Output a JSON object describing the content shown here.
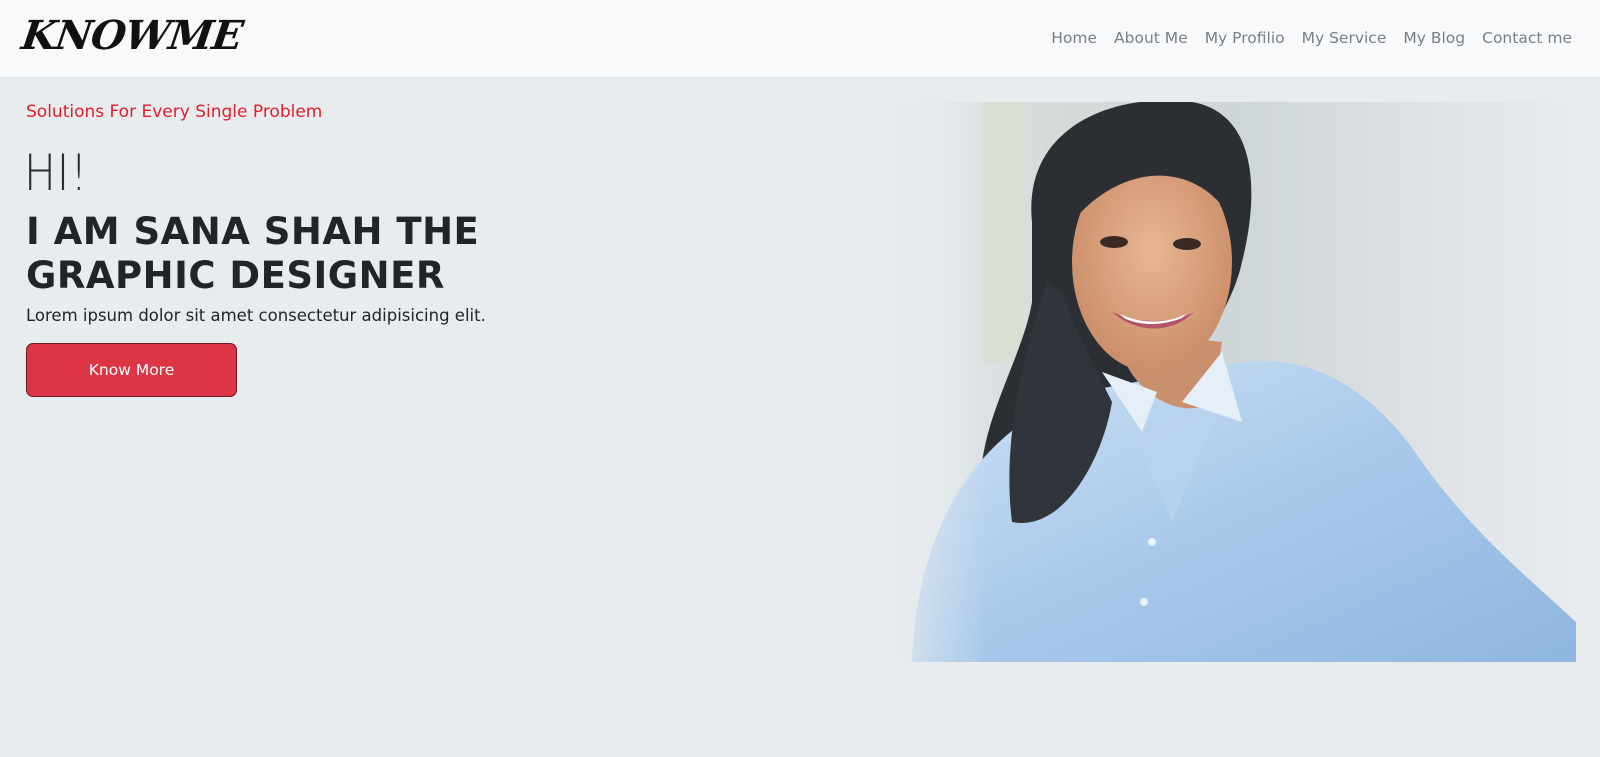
{
  "brand": {
    "name": "KNOWME"
  },
  "nav": {
    "items": [
      {
        "label": "Home"
      },
      {
        "label": "About Me"
      },
      {
        "label": "My Profilio"
      },
      {
        "label": "My Service"
      },
      {
        "label": "My Blog"
      },
      {
        "label": "Contact me"
      }
    ]
  },
  "hero": {
    "tagline": "Solutions For Every Single Problem",
    "greeting": "HI!",
    "headline": "I AM SANA SHAH THE GRAPHIC DESIGNER",
    "description": "Lorem ipsum dolor sit amet consectetur adipisicing elit.",
    "cta_label": "Know More",
    "photo": {
      "icon": "portrait-photo"
    }
  },
  "colors": {
    "page_bg": "#e9ecef",
    "navbar_bg": "#f8f9fa",
    "tagline": "#e01e2a",
    "button_bg": "#dc3545",
    "nav_link": "#7a7f85"
  }
}
